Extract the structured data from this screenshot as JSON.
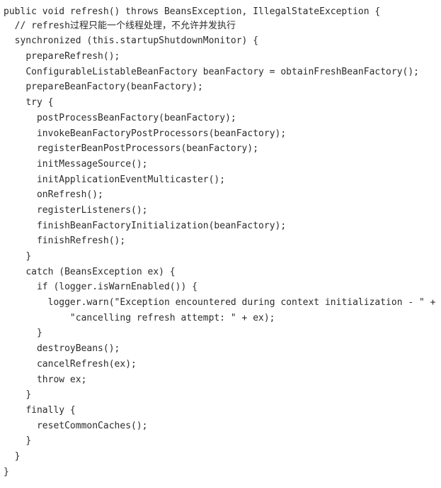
{
  "document": {
    "kind": "source-code-listing",
    "language": "Java",
    "method_name": "refresh",
    "background_color": "#ffffff",
    "text_color": "#2b2b2b",
    "indent_unit": "  ",
    "line_count": 31
  },
  "code": {
    "lines": [
      {
        "indent": 0,
        "text": "public void refresh() throws BeansException, IllegalStateException {"
      },
      {
        "indent": 1,
        "text": "// refresh过程只能一个线程处理，不允许并发执行"
      },
      {
        "indent": 1,
        "text": "synchronized (this.startupShutdownMonitor) {"
      },
      {
        "indent": 2,
        "text": "prepareRefresh();"
      },
      {
        "indent": 2,
        "text": "ConfigurableListableBeanFactory beanFactory = obtainFreshBeanFactory();"
      },
      {
        "indent": 2,
        "text": "prepareBeanFactory(beanFactory);"
      },
      {
        "indent": 2,
        "text": "try {"
      },
      {
        "indent": 3,
        "text": "postProcessBeanFactory(beanFactory);"
      },
      {
        "indent": 3,
        "text": "invokeBeanFactoryPostProcessors(beanFactory);"
      },
      {
        "indent": 3,
        "text": "registerBeanPostProcessors(beanFactory);"
      },
      {
        "indent": 3,
        "text": "initMessageSource();"
      },
      {
        "indent": 3,
        "text": "initApplicationEventMulticaster();"
      },
      {
        "indent": 3,
        "text": "onRefresh();"
      },
      {
        "indent": 3,
        "text": "registerListeners();"
      },
      {
        "indent": 3,
        "text": "finishBeanFactoryInitialization(beanFactory);"
      },
      {
        "indent": 3,
        "text": "finishRefresh();"
      },
      {
        "indent": 2,
        "text": "}"
      },
      {
        "indent": 2,
        "text": "catch (BeansException ex) {"
      },
      {
        "indent": 3,
        "text": "if (logger.isWarnEnabled()) {"
      },
      {
        "indent": 4,
        "text": "logger.warn(\"Exception encountered during context initialization - \" +"
      },
      {
        "indent": 6,
        "text": "\"cancelling refresh attempt: \" + ex);"
      },
      {
        "indent": 3,
        "text": "}"
      },
      {
        "indent": 3,
        "text": "destroyBeans();"
      },
      {
        "indent": 3,
        "text": "cancelRefresh(ex);"
      },
      {
        "indent": 3,
        "text": "throw ex;"
      },
      {
        "indent": 2,
        "text": "}"
      },
      {
        "indent": 2,
        "text": "finally {"
      },
      {
        "indent": 3,
        "text": "resetCommonCaches();"
      },
      {
        "indent": 2,
        "text": "}"
      },
      {
        "indent": 1,
        "text": "}"
      },
      {
        "indent": 0,
        "text": "}"
      }
    ]
  }
}
